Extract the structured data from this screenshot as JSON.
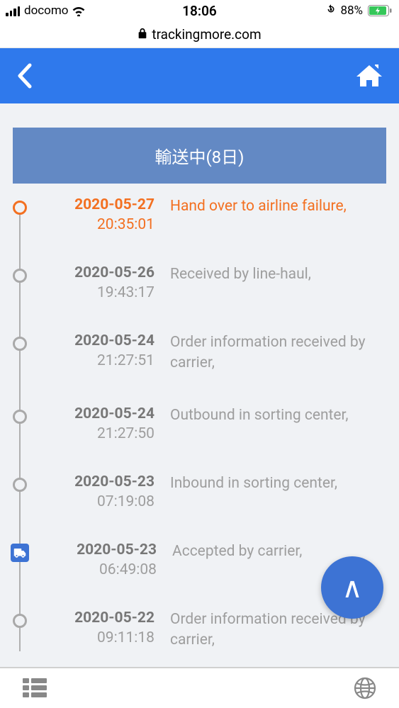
{
  "status_bar": {
    "carrier": "docomo",
    "time": "18:06",
    "battery": "88%"
  },
  "browser": {
    "domain": "trackingmore.com"
  },
  "shipment": {
    "status_label": "輸送中(8日)"
  },
  "fab": {
    "label": "∧"
  },
  "events": [
    {
      "date": "2020-05-27",
      "time": "20:35:01",
      "desc": "Hand over to airline failure,",
      "current": true,
      "truck": false
    },
    {
      "date": "2020-05-26",
      "time": "19:43:17",
      "desc": "Received by line-haul,",
      "current": false,
      "truck": false
    },
    {
      "date": "2020-05-24",
      "time": "21:27:51",
      "desc": "Order information received by carrier,",
      "current": false,
      "truck": false
    },
    {
      "date": "2020-05-24",
      "time": "21:27:50",
      "desc": "Outbound in sorting center,",
      "current": false,
      "truck": false
    },
    {
      "date": "2020-05-23",
      "time": "07:19:08",
      "desc": "Inbound in sorting center,",
      "current": false,
      "truck": false
    },
    {
      "date": "2020-05-23",
      "time": "06:49:08",
      "desc": "Accepted by carrier,",
      "current": false,
      "truck": true
    },
    {
      "date": "2020-05-22",
      "time": "09:11:18",
      "desc": "Order information received by carrier,",
      "current": false,
      "truck": false
    }
  ]
}
